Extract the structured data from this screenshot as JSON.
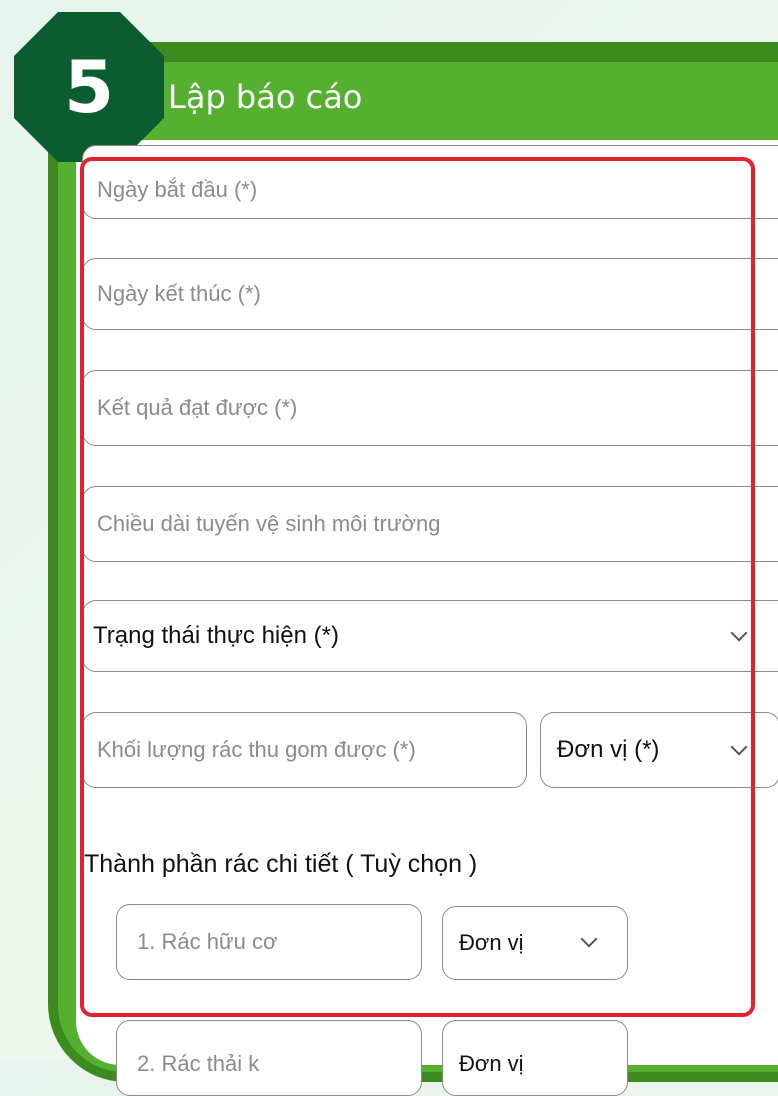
{
  "step": {
    "number": "5",
    "title": "Lập báo cáo"
  },
  "form": {
    "start_date_placeholder": "Ngày bắt đầu (*)",
    "end_date_placeholder": "Ngày kết thúc (*)",
    "result_placeholder": "Kết quả đạt được (*)",
    "route_length_placeholder": "Chiều dài tuyến vệ sinh môi trường",
    "status_select_label": "Trạng thái thực hiện (*)",
    "waste_weight_placeholder": "Khối lượng rác thu gom được (*)",
    "unit_select_label": "Đơn vị (*)",
    "detail_section_title": "Thành phần rác chi tiết ( Tuỳ chọn )",
    "detail_items": [
      {
        "placeholder": "1. Rác hữu cơ",
        "unit_label": "Đơn vị"
      },
      {
        "placeholder": "2. Rác thải k",
        "unit_label": "Đơn vị"
      }
    ]
  },
  "colors": {
    "frame_dark": "#3d8a1f",
    "frame_light": "#55b02f",
    "badge": "#0b5d2f",
    "highlight": "#e3222e"
  },
  "icons": [
    "chevron-down-icon"
  ]
}
